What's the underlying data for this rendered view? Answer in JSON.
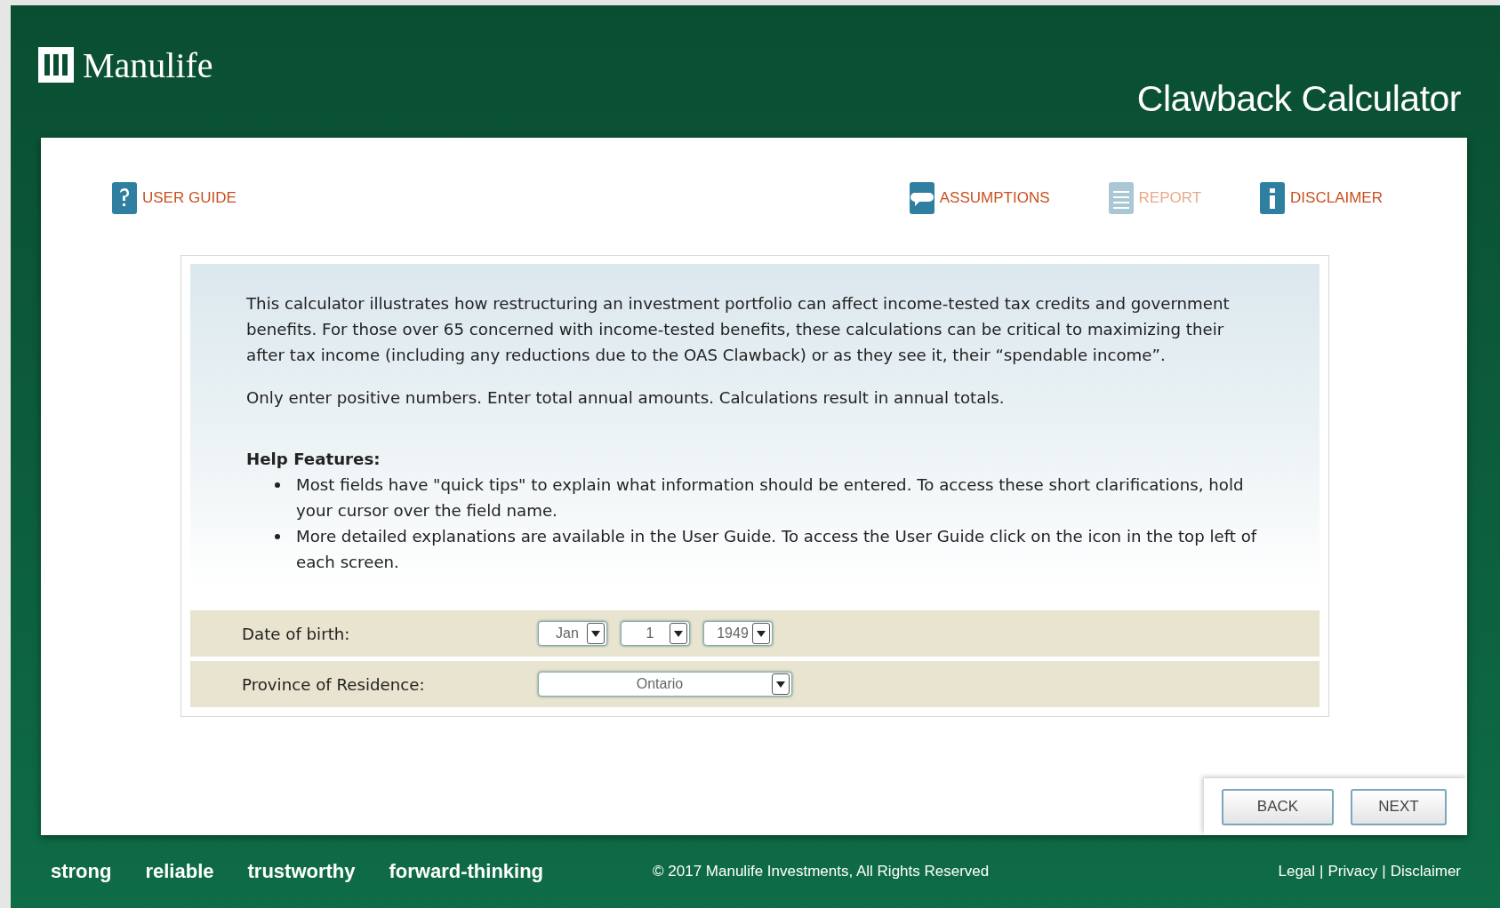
{
  "header": {
    "logo": "Manulife",
    "title": "Clawback Calculator"
  },
  "nav": {
    "left": [
      {
        "label": "USER GUIDE",
        "disabled": false
      }
    ],
    "right": [
      {
        "label": "ASSUMPTIONS",
        "disabled": false
      },
      {
        "label": "REPORT",
        "disabled": true
      },
      {
        "label": "DISCLAIMER",
        "disabled": false
      }
    ]
  },
  "intro": {
    "paragraphs": [
      "This calculator illustrates how restructuring an investment portfolio can affect income-tested tax credits and government benefits. For those over 65 concerned with income-tested benefits, these calculations can be critical to maximizing their after tax income (including any reductions due to the OAS Clawback) or as they see it, their “spendable income”.",
      "Only enter positive numbers. Enter total annual amounts. Calculations result in annual totals."
    ],
    "help_title": "Help Features:",
    "help_items": [
      "Most fields have \"quick tips\" to explain what information should be entered. To access these short clarifications, hold your cursor over the field name.",
      "More detailed explanations are available in the User Guide. To access the User Guide click on the icon in the top left of each screen."
    ]
  },
  "form": [
    {
      "label": "Date of birth:",
      "selects": [
        {
          "value": "Jan",
          "kind": "small"
        },
        {
          "value": "1",
          "kind": "small"
        },
        {
          "value": "1949",
          "kind": "small"
        }
      ]
    },
    {
      "label": "Province of Residence:",
      "selects": [
        {
          "value": "Ontario",
          "kind": "wide"
        }
      ]
    }
  ],
  "buttons": [
    "BACK",
    "NEXT"
  ],
  "footer": {
    "words": [
      "strong",
      "reliable",
      "trustworthy",
      "forward-thinking"
    ],
    "copyright": "© 2017 Manulife Investments, All Rights Reserved",
    "links": [
      "Legal",
      "Privacy",
      "Disclaimer"
    ],
    "separator": "|"
  }
}
